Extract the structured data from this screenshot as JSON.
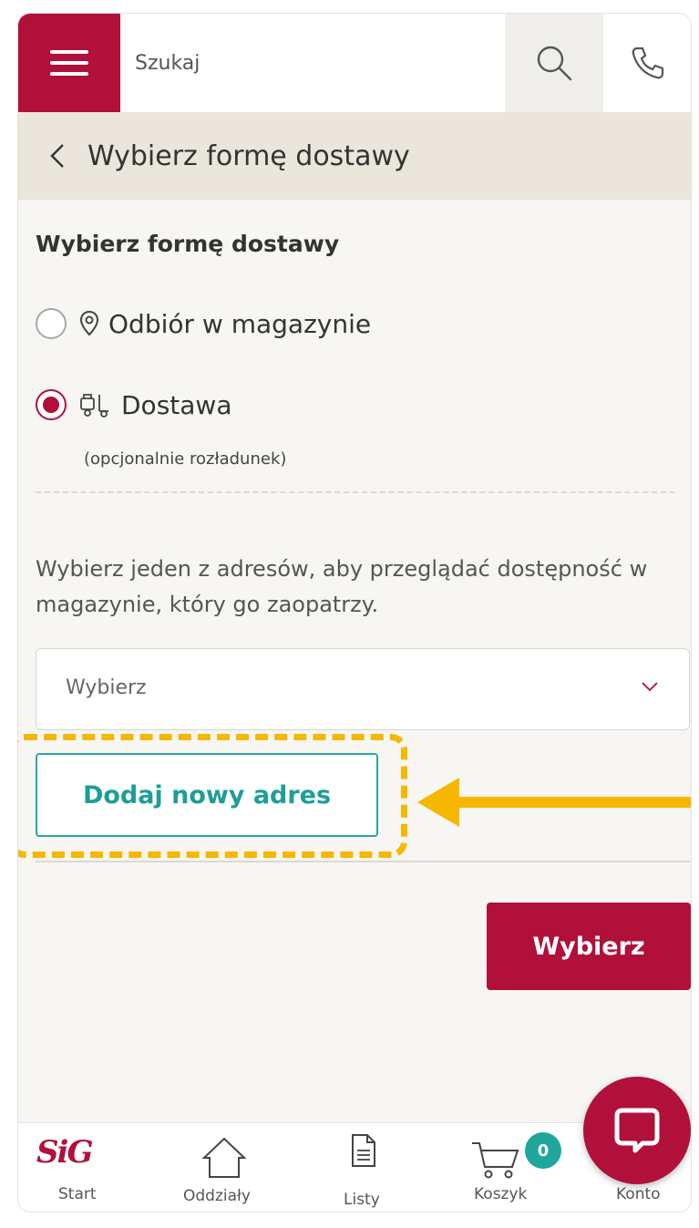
{
  "header": {
    "search_placeholder": "Szukaj"
  },
  "subheader": {
    "title": "Wybierz formę dostawy"
  },
  "delivery": {
    "section_title": "Wybierz formę dostawy",
    "options": [
      {
        "label": "Odbiór w magazynie",
        "selected": false,
        "icon": "location-pin-icon"
      },
      {
        "label": "Dostawa",
        "sub": "(opcjonalnie rozładunek)",
        "selected": true,
        "icon": "delivery-truck-icon"
      }
    ],
    "info_text": "Wybierz jeden z adresów, aby przeglądać dostępność w magazynie, który go zaopatrzy.",
    "address_select_value": "Wybierz",
    "add_address_label": "Dodaj nowy adres",
    "submit_label": "Wybierz"
  },
  "bottom_nav": {
    "items": [
      {
        "label": "Start",
        "icon": "sig-logo"
      },
      {
        "label": "Oddziały",
        "icon": "home-icon"
      },
      {
        "label": "Listy",
        "icon": "document-icon"
      },
      {
        "label": "Koszyk",
        "icon": "cart-icon"
      },
      {
        "label": "Konto",
        "icon": "account-icon"
      }
    ],
    "cart_count": "0",
    "logo_text": "SiG"
  },
  "colors": {
    "brand": "#b0103a",
    "accent_teal": "#1e9e96",
    "highlight": "#f5b700",
    "subheader_bg": "#ebe6dc",
    "page_bg": "#f7f6f3"
  }
}
